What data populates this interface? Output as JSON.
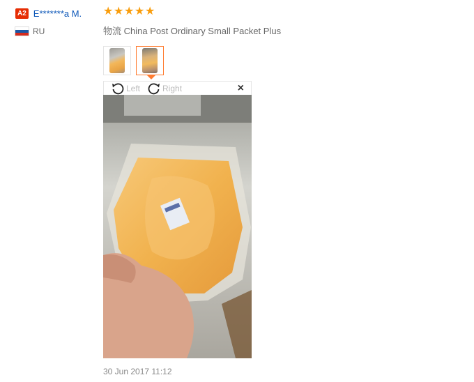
{
  "user": {
    "badge": "A2",
    "name": "E*******a M.",
    "country": "RU"
  },
  "review": {
    "rating": 5,
    "logistics_label": "物流",
    "logistics_value": "China Post Ordinary Small Packet Plus",
    "date": "30 Jun 2017 11:12"
  },
  "viewer": {
    "rotate_left": "Left",
    "rotate_right": "Right",
    "close": "×"
  },
  "colors": {
    "star": "#f99d0c",
    "name_link": "#0b56b8",
    "badge": "#e62e04",
    "active_thumb": "#ff7a2e"
  }
}
